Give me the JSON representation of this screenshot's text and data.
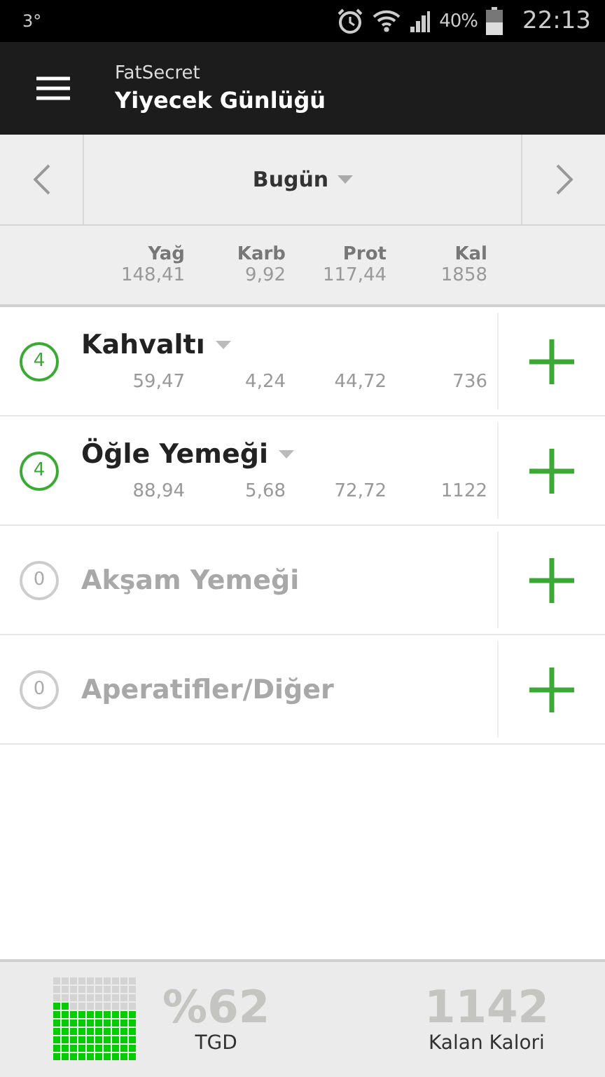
{
  "status_bar": {
    "temperature": "3°",
    "battery_text": "40%",
    "time": "22:13"
  },
  "app_bar": {
    "app_name": "FatSecret",
    "title": "Yiyecek Günlüğü"
  },
  "date_nav": {
    "label": "Bugün"
  },
  "totals": {
    "columns": [
      "Yağ",
      "Karb",
      "Prot",
      "Kal"
    ],
    "values": [
      "148,41",
      "9,92",
      "117,44",
      "1858"
    ]
  },
  "meals": [
    {
      "count": "4",
      "name": "Kahvaltı",
      "active": true,
      "values": [
        "59,47",
        "4,24",
        "44,72",
        "736"
      ]
    },
    {
      "count": "4",
      "name": "Öğle Yemeği",
      "active": true,
      "values": [
        "88,94",
        "5,68",
        "72,72",
        "1122"
      ]
    },
    {
      "count": "0",
      "name": "Akşam Yemeği",
      "active": false
    },
    {
      "count": "0",
      "name": "Aperatifler/Diğer",
      "active": false
    }
  ],
  "footer": {
    "percent": "%62",
    "percent_label": "TGD",
    "remaining": "1142",
    "remaining_label": "Kalan Kalori"
  }
}
